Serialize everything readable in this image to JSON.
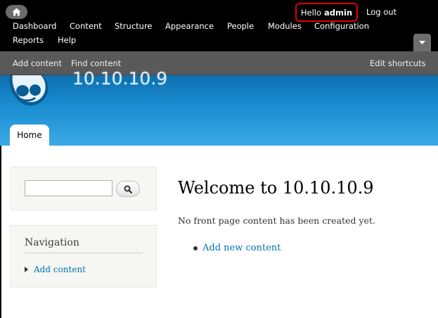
{
  "toolbar": {
    "user_greeting": "Hello",
    "user_name": "admin",
    "logout_label": "Log out",
    "menu": [
      "Dashboard",
      "Content",
      "Structure",
      "Appearance",
      "People",
      "Modules",
      "Configuration",
      "Reports",
      "Help"
    ]
  },
  "shortcuts": {
    "items": [
      "Add content",
      "Find content"
    ],
    "edit_label": "Edit shortcuts"
  },
  "header": {
    "site_name": "10.10.10.9",
    "tabs": [
      "Home"
    ]
  },
  "sidebar": {
    "search_value": "",
    "navigation": {
      "title": "Navigation",
      "items": [
        "Add content"
      ]
    }
  },
  "main": {
    "title": "Welcome to 10.10.10.9",
    "message": "No front page content has been created yet.",
    "links": [
      "Add new content"
    ]
  },
  "colors": {
    "toolbar_bg": "#000000",
    "shortcuts_bg": "#595959",
    "header_top": "#0d6fb0",
    "header_bottom": "#3da9e6",
    "link": "#0071b3",
    "highlight_border": "#e00000"
  }
}
